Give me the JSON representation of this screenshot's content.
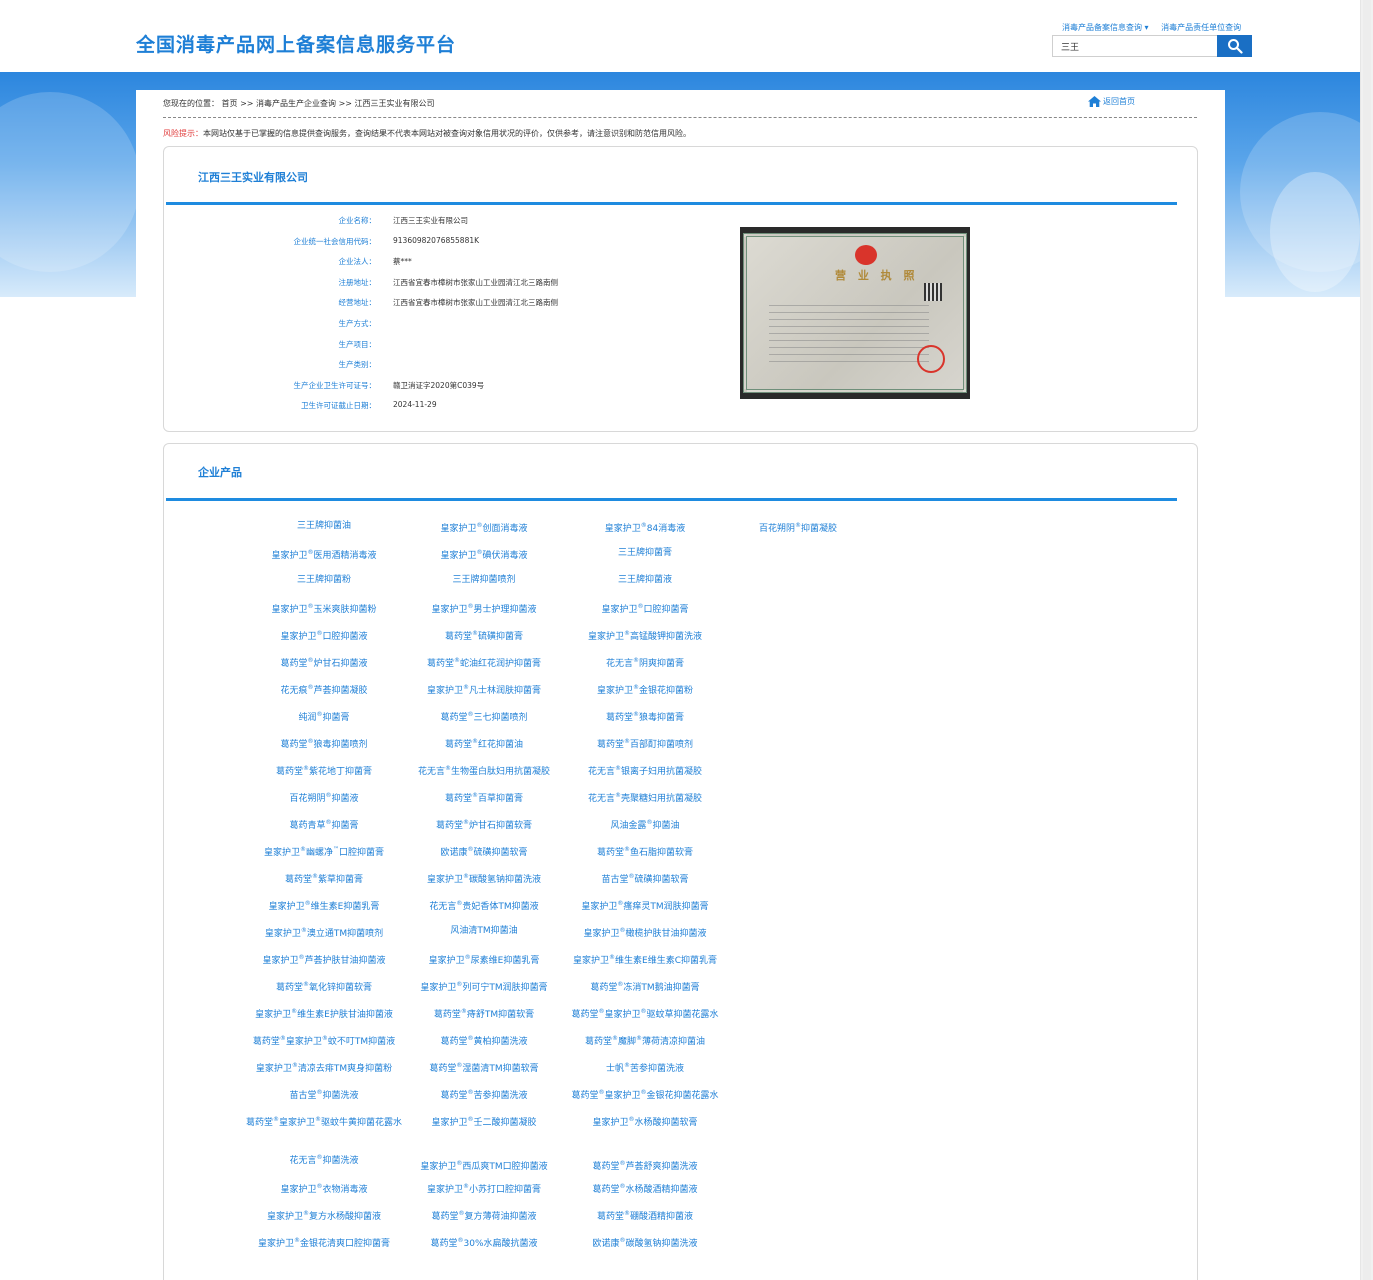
{
  "header": {
    "site_title": "全国消毒产品网上备案信息服务平台",
    "link_filing": "消毒产品备案信息查询 ▾",
    "link_responsible": "消毒产品责任单位查询",
    "search_value": "三王"
  },
  "breadcrumb": {
    "prefix": "您现在的位置：",
    "home": "首页",
    "sep": " >> ",
    "level2": "消毒产品生产企业查询",
    "level3": "江西三王实业有限公司",
    "back_home": "返回首页"
  },
  "risk": {
    "label": "风险提示：",
    "text": "本网站仅基于已掌握的信息提供查询服务，查询结果不代表本网站对被查询对象信用状况的评价，仅供参考，请注意识别和防范信用风险。"
  },
  "company": {
    "title": "江西三王实业有限公司",
    "fields": [
      {
        "label": "企业名称：",
        "value": "江西三王实业有限公司"
      },
      {
        "label": "企业统一社会信用代码：",
        "value": "91360982076855881K"
      },
      {
        "label": "企业法人：",
        "value": "蔡***"
      },
      {
        "label": "注册地址：",
        "value": "江西省宜春市樟树市张家山工业园清江北三路南侧"
      },
      {
        "label": "经营地址：",
        "value": "江西省宜春市樟树市张家山工业园清江北三路南侧"
      },
      {
        "label": "生产方式：",
        "value": ""
      },
      {
        "label": "生产项目：",
        "value": ""
      },
      {
        "label": "生产类别：",
        "value": ""
      },
      {
        "label": "生产企业卫生许可证号：",
        "value": "赣卫消证字2020第C039号"
      },
      {
        "label": "卫生许可证截止日期：",
        "value": "2024-11-29"
      }
    ],
    "license_title": "营 业 执 照"
  },
  "products": {
    "title": "企业产品",
    "items": [
      "三王牌抑菌油",
      "皇家护卫®创面消毒液",
      "皇家护卫®84消毒液",
      "百花朔阴®抑菌凝胶",
      "皇家护卫®医用酒精消毒液",
      "皇家护卫®碘伏消毒液",
      "三王牌抑菌膏",
      "三王牌抑菌粉",
      "三王牌抑菌喷剂",
      "三王牌抑菌液",
      "皇家护卫®玉米爽肤抑菌粉",
      "皇家护卫®男士护理抑菌液",
      "皇家护卫®口腔抑菌膏",
      "皇家护卫®口腔抑菌液",
      "葛药堂®硫磺抑菌膏",
      "皇家护卫®高锰酸钾抑菌洗液",
      "葛药堂®炉甘石抑菌液",
      "葛药堂®蛇油红花润护抑菌膏",
      "花无言®阴爽抑菌膏",
      "花无痕®芦荟抑菌凝胶",
      "皇家护卫®凡士林润肤抑菌膏",
      "皇家护卫®金银花抑菌粉",
      "纯润®抑菌膏",
      "葛药堂®三七抑菌喷剂",
      "葛药堂®狼毒抑菌膏",
      "葛药堂®狼毒抑菌喷剂",
      "葛药堂®红花抑菌油",
      "葛药堂®百部酊抑菌喷剂",
      "葛药堂®紫花地丁抑菌膏",
      "花无言®生物蛋白肽妇用抗菌凝胶",
      "花无言®银离子妇用抗菌凝胶",
      "百花朔阴®抑菌液",
      "葛药堂®百草抑菌膏",
      "花无言®壳聚糖妇用抗菌凝胶",
      "葛药青草®抑菌膏",
      "葛药堂®炉甘石抑菌软膏",
      "风油金露®抑菌油",
      "皇家护卫®幽螺净™口腔抑菌膏",
      "欧诺康®硫磺抑菌软膏",
      "葛药堂®鱼石脂抑菌软膏",
      "葛药堂®紫草抑菌膏",
      "皇家护卫®碳酸氢钠抑菌洗液",
      "苗古堂®硫磺抑菌软膏",
      "皇家护卫®维生素E抑菌乳膏",
      "花无言®贵妃香体TM抑菌液",
      "皇家护卫®瘙痒灵TM润肤抑菌膏",
      "皇家护卫®澳立通TM抑菌喷剂",
      "风油清TM抑菌油",
      "皇家护卫®橄榄护肤甘油抑菌液",
      "皇家护卫®芦荟护肤甘油抑菌液",
      "皇家护卫®尿素维E抑菌乳膏",
      "皇家护卫®维生素E维生素C抑菌乳膏",
      "葛药堂®氧化锌抑菌软膏",
      "皇家护卫®列可宁TM润肤抑菌膏",
      "葛药堂®冻消TM鹅油抑菌膏",
      "皇家护卫®维生素E护肤甘油抑菌液",
      "葛药堂®痔舒TM抑菌软膏",
      "葛药堂®皇家护卫®驱蚊草抑菌花露水",
      "葛药堂®皇家护卫®蚊不叮TM抑菌液",
      "葛药堂®黄柏抑菌洗液",
      "葛药堂®魔脚®薄荷清凉抑菌油",
      "皇家护卫®清凉去痱TM爽身抑菌粉",
      "葛药堂®湿菌清TM抑菌软膏",
      "士帆®苦参抑菌洗液",
      "苗古堂®抑菌洗液",
      "葛药堂®苦参抑菌洗液",
      "葛药堂®皇家护卫®金银花抑菌花露水",
      "葛药堂®皇家护卫®驱蚊牛黄抑菌花露水",
      "皇家护卫®壬二酸抑菌凝胶",
      "皇家护卫®水杨酸抑菌软膏",
      "花无言®抑菌洗液",
      "皇家护卫®西瓜爽TM口腔抑菌液",
      "葛药堂®芦荟舒爽抑菌洗液",
      "皇家护卫®衣物消毒液",
      "皇家护卫®小苏打口腔抑菌膏",
      "葛药堂®水杨酸酒精抑菌液",
      "皇家护卫®复方水杨酸抑菌液",
      "葛药堂®复方薄荷油抑菌液",
      "葛药堂®硼酸酒精抑菌液",
      "皇家护卫®金银花清爽口腔抑菌膏",
      "葛药堂®30%水扁酸抗菌液",
      "欧诺康®碳酸氢钠抑菌洗液"
    ]
  },
  "colors": {
    "brand_blue": "#1e7fd6",
    "accent_line": "#1e8be0",
    "risk_red": "#e03a3a",
    "search_button": "#1a6fc4"
  }
}
